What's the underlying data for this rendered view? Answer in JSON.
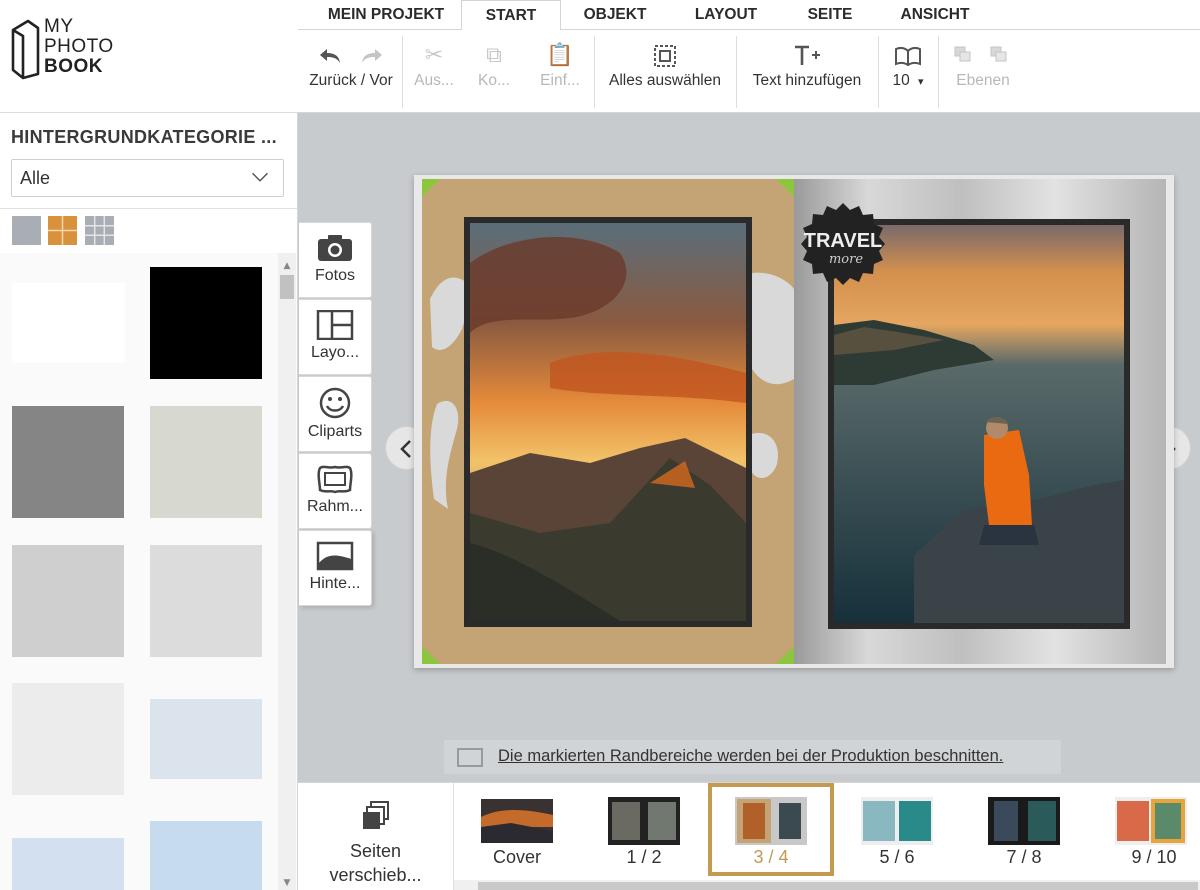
{
  "brand": {
    "line1": "MY",
    "line2": "PHOTO",
    "line3": "BOOK"
  },
  "menu": {
    "tabs": [
      {
        "label": "MEIN PROJEKT",
        "active": false
      },
      {
        "label": "START",
        "active": true
      },
      {
        "label": "OBJEKT",
        "active": false
      },
      {
        "label": "LAYOUT",
        "active": false
      },
      {
        "label": "SEITE",
        "active": false
      },
      {
        "label": "ANSICHT",
        "active": false
      }
    ]
  },
  "toolbar": {
    "undo_redo": "Zurück / Vor",
    "cut": "Aus...",
    "copy": "Ko...",
    "paste": "Einf...",
    "select_all": "Alles auswählen",
    "add_text": "Text hinzufügen",
    "page_count": "10",
    "page_count_caret": "▾",
    "layers": "Ebenen"
  },
  "sidebar": {
    "title": "HINTERGRUNDKATEGORIE ...",
    "category_select": "Alle",
    "swatch_colors": [
      "#ffffff",
      "#000000",
      "#858585",
      "#d7d8d0",
      "#cfcfcf",
      "#dcdcdc",
      "#ececec",
      "#dbe4ec",
      "#d2e0f0",
      "#c6dbee"
    ]
  },
  "side_tabs": {
    "photos": "Fotos",
    "layouts": "Layo...",
    "cliparts": "Cliparts",
    "frames": "Rahm...",
    "backgrounds": "Hinte..."
  },
  "canvas": {
    "badge_line1": "TRAVEL",
    "badge_line2": "more",
    "notice": "Die markierten Randbereiche werden bei der Produktion beschnitten."
  },
  "pagestrip": {
    "move_label_1": "Seiten",
    "move_label_2": "verschieb...",
    "pages": [
      {
        "label": "Cover",
        "active": false
      },
      {
        "label": "1 / 2",
        "active": false
      },
      {
        "label": "3 / 4",
        "active": true
      },
      {
        "label": "5 / 6",
        "active": false
      },
      {
        "label": "7 / 8",
        "active": false
      },
      {
        "label": "9 / 10",
        "active": false
      }
    ]
  },
  "colors": {
    "accent": "#c49a51",
    "corner_green": "#8cc63f",
    "kraft": "#c4a375"
  }
}
